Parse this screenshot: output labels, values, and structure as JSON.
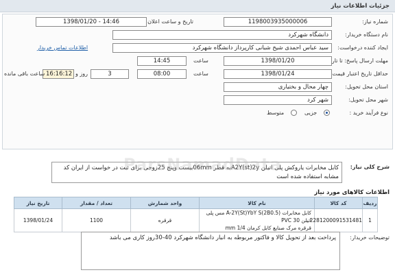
{
  "header": {
    "title": "جزئیات اطلاعات نیاز"
  },
  "form": {
    "need_number": {
      "label": "شماره نیاز:",
      "value": "1198003935000006"
    },
    "announce_datetime": {
      "label": "تاریخ و ساعت اعلان عمومی:",
      "value": "1398/01/20 - 14:46"
    },
    "buyer_org": {
      "label": "نام دستگاه خریدار:",
      "value": "دانشگاه شهرکرد"
    },
    "creator": {
      "label": "ایجاد کننده درخواست:",
      "value": "سید عباس احمدی شیخ شبانی کارپرداز دانشگاه شهرکرد",
      "contact_link": "اطلاعات تماس خریدار"
    },
    "reply_deadline": {
      "label": "مهلت ارسال پاسخ: تا تاریخ:",
      "date": "1398/01/20",
      "time_label": "ساعت",
      "time": "14:45"
    },
    "validity": {
      "label": "حداقل تاریخ اعتبار قیمت: تا تاریخ:",
      "date": "1398/01/24",
      "time_label": "ساعت",
      "time": "08:00",
      "days": "3",
      "days_label": "روز و",
      "remaining": "16:16:12",
      "remaining_label": "ساعت باقی مانده"
    },
    "province": {
      "label": "استان محل تحویل:",
      "value": "چهار محال و بختیاری"
    },
    "city": {
      "label": "شهر محل تحویل:",
      "value": "شهر کرد"
    },
    "purchase_type": {
      "label": "نوع فرآیند خرید :",
      "options": [
        "جزیی",
        "متوسط"
      ],
      "selected": "جزیی"
    }
  },
  "description": {
    "label": "شرح کلی نیاز:",
    "text": "کابل مخابرات یاروکش پلی اتیلن A2Y(st)2yبه قطر 06mmبیست وپنج 25زوجی برای ثبت در خواست از ایران کد مشابه استفاده شده است"
  },
  "items_section": {
    "title": "اطلاعات کالاهای مورد نیاز"
  },
  "items_table": {
    "headers": [
      "ردیف",
      "کد کالا",
      "نام کالا",
      "واحد شمارش",
      "تعداد / مقدار",
      "تاریخ نیاز"
    ],
    "rows": [
      {
        "row": "1",
        "code": "2281200091531481",
        "name_line1": "کابل مخابرات A-2Y(St)YbY S(2B0.5) مس پلی اتیلن PVC 30",
        "name_line2": "قرقره مرک صنایع کابل کرمان 1/4 mm",
        "unit": "قرقره",
        "qty": "1100",
        "date": "1398/01/24"
      }
    ]
  },
  "notes": {
    "label": "توضیحات خریدار:",
    "text": "پرداخت بعد از تحویل کالا و فاکتور مربوطه به انبار دانشگاه شهرکرد 40-30روز کاری می باشد"
  },
  "watermark": {
    "text": "ParsNamadData"
  }
}
